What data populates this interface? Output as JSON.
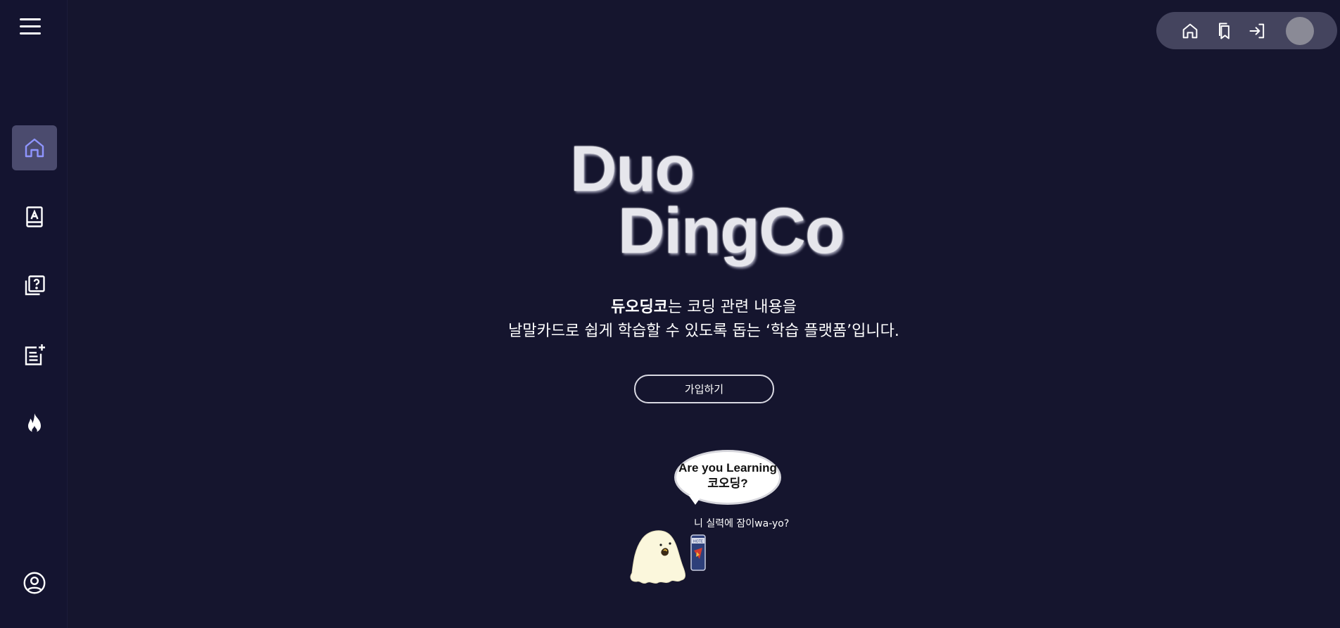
{
  "sidebar": {
    "menu_icon": "hamburger-menu-icon",
    "items": [
      {
        "name": "home",
        "icon": "home-icon",
        "active": true
      },
      {
        "name": "study-book",
        "icon": "book-icon",
        "active": false
      },
      {
        "name": "quiz",
        "icon": "question-cards-icon",
        "active": false
      },
      {
        "name": "add-post",
        "icon": "note-add-icon",
        "active": false
      },
      {
        "name": "hot",
        "icon": "fire-icon",
        "active": false
      }
    ],
    "profile_icon": "user-circle-icon"
  },
  "topbar": {
    "icons": [
      "home-icon",
      "bookmarks-icon",
      "login-icon"
    ],
    "avatar": "avatar"
  },
  "hero": {
    "logo_line1": "Duo",
    "logo_line2": "DingCo",
    "desc_bold": "듀오딩코",
    "desc_line1_rest": "는 코딩 관련 내용을",
    "desc_line2": "날말카드로 쉽게 학습할 수 있도록 돕는 ‘학습 플랫폼’입니다.",
    "signup_label": "가입하기"
  },
  "mascot": {
    "bubble_line1": "Are you Learning",
    "bubble_line2": "코오딩?",
    "caption": "니 실력에 잠이wa-yo?",
    "can_label": "HOTE"
  },
  "colors": {
    "background": "#15152e",
    "active_item": "#4b4b6e",
    "topbar": "#44445e",
    "accent_icon": "#8f95ff"
  }
}
